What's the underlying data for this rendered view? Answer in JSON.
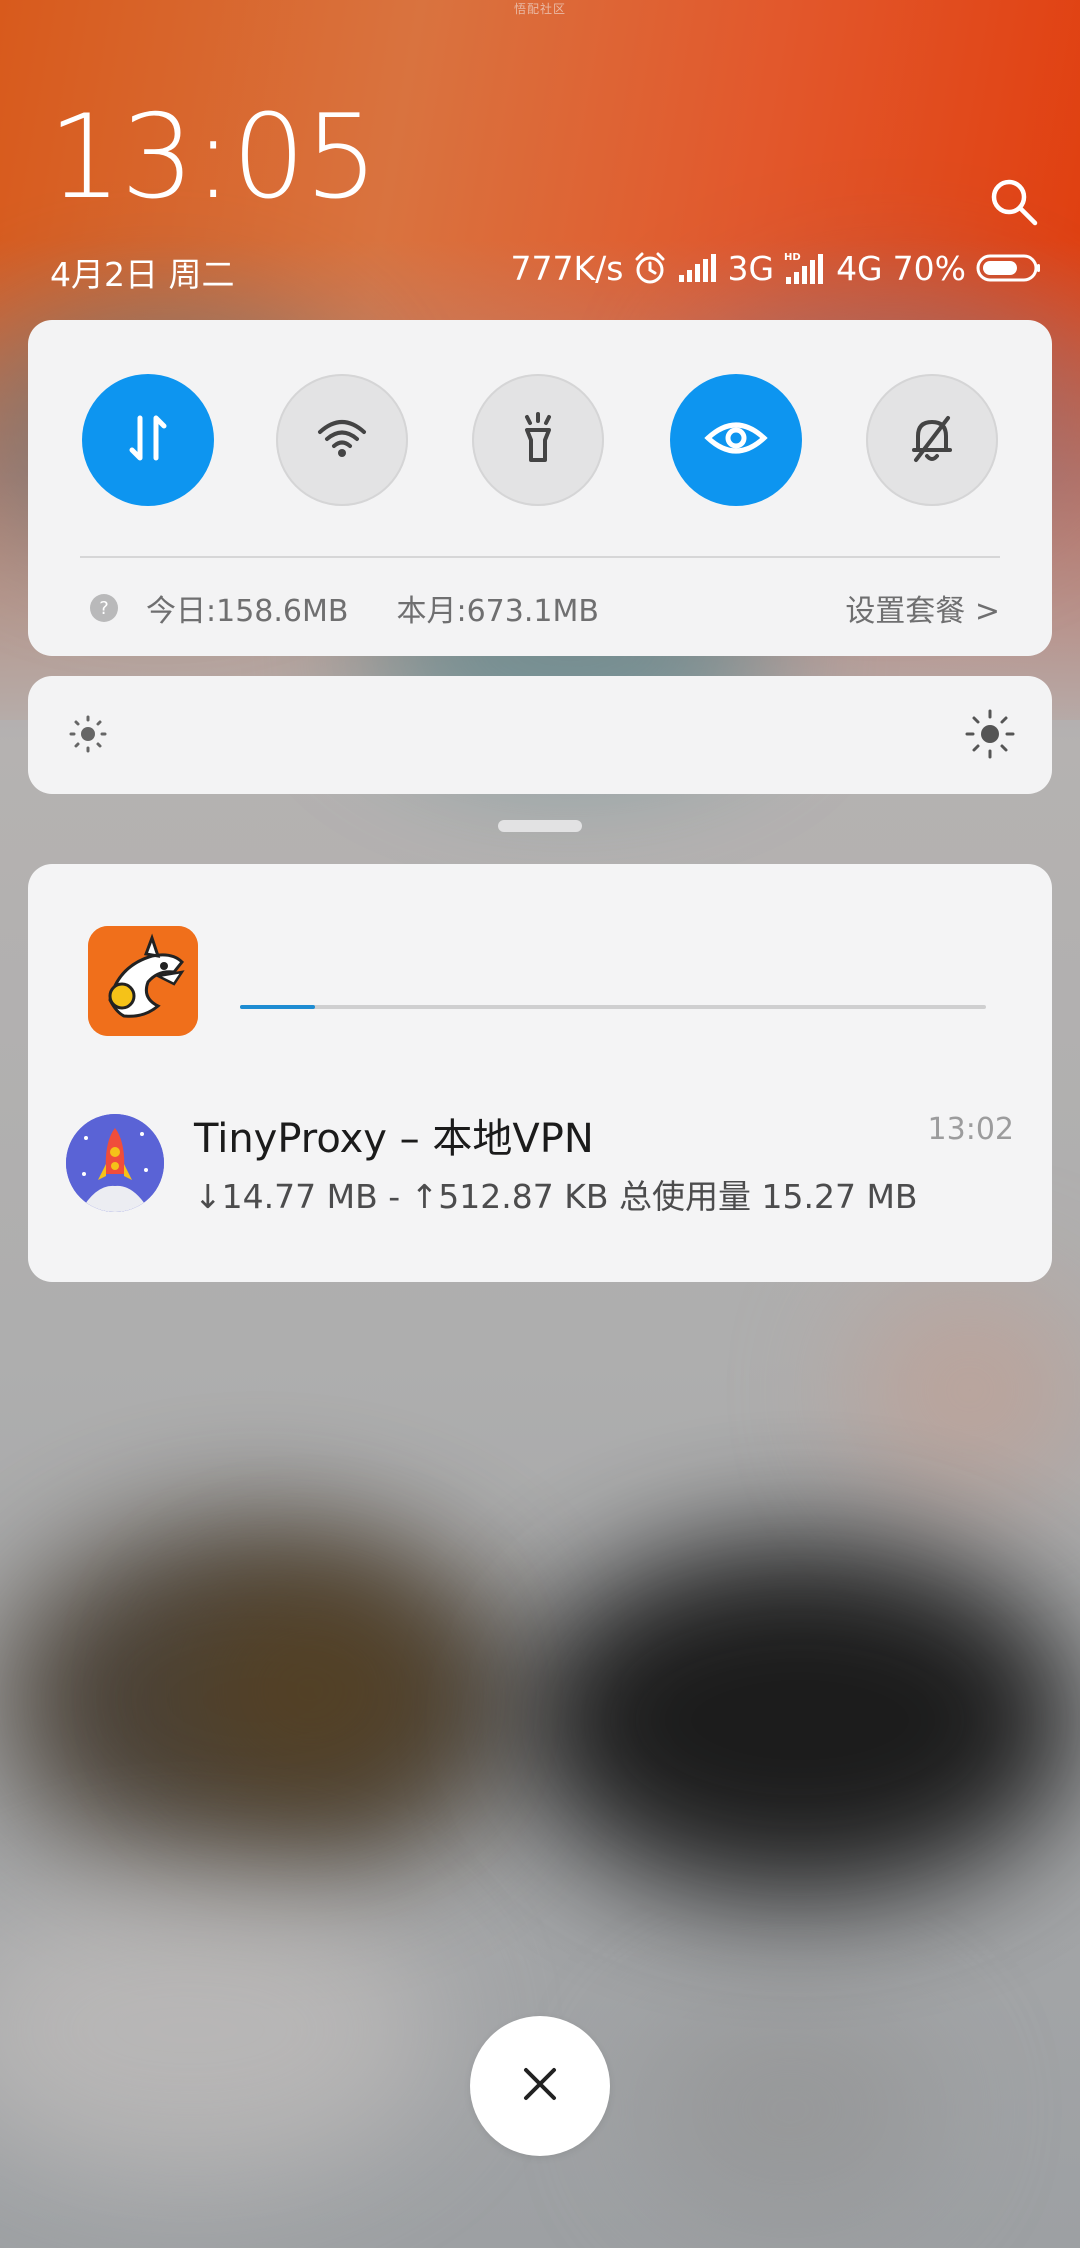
{
  "watermark": "悟配社区",
  "lockscreen": {
    "time": "13:05",
    "date": "4月2日 周二"
  },
  "status_bar": {
    "net_speed": "777K/s",
    "network_1": "3G",
    "network_2": "4G",
    "battery_percent": "70%",
    "battery_level": 0.7,
    "icons": [
      "alarm-icon",
      "signal-icon",
      "hd-signal-icon",
      "battery-icon"
    ]
  },
  "quick_settings": {
    "toggles": [
      {
        "name": "mobile-data",
        "icon": "data-arrows-icon",
        "state": "on"
      },
      {
        "name": "wifi",
        "icon": "wifi-icon",
        "state": "off"
      },
      {
        "name": "flashlight",
        "icon": "flashlight-icon",
        "state": "off"
      },
      {
        "name": "reading-mode",
        "icon": "eye-icon",
        "state": "on"
      },
      {
        "name": "silent",
        "icon": "bell-off-icon",
        "state": "off"
      }
    ],
    "usage_today": "今日:158.6MB",
    "usage_month": "本月:673.1MB",
    "set_plan": "设置套餐 >"
  },
  "brightness": {
    "level": 0.0
  },
  "notifications": {
    "download": {
      "icon": "shark-app-icon",
      "progress": 0.1
    },
    "vpn": {
      "icon": "rocket-app-icon",
      "title": "TinyProxy – 本地VPN",
      "time": "13:02",
      "detail": "↓14.77 MB - ↑512.87 KB 总使用量 15.27 MB"
    }
  },
  "colors": {
    "accent": "#0d95f0",
    "top_orange": "#e03a0a",
    "card_bg": "#f4f4f5"
  }
}
